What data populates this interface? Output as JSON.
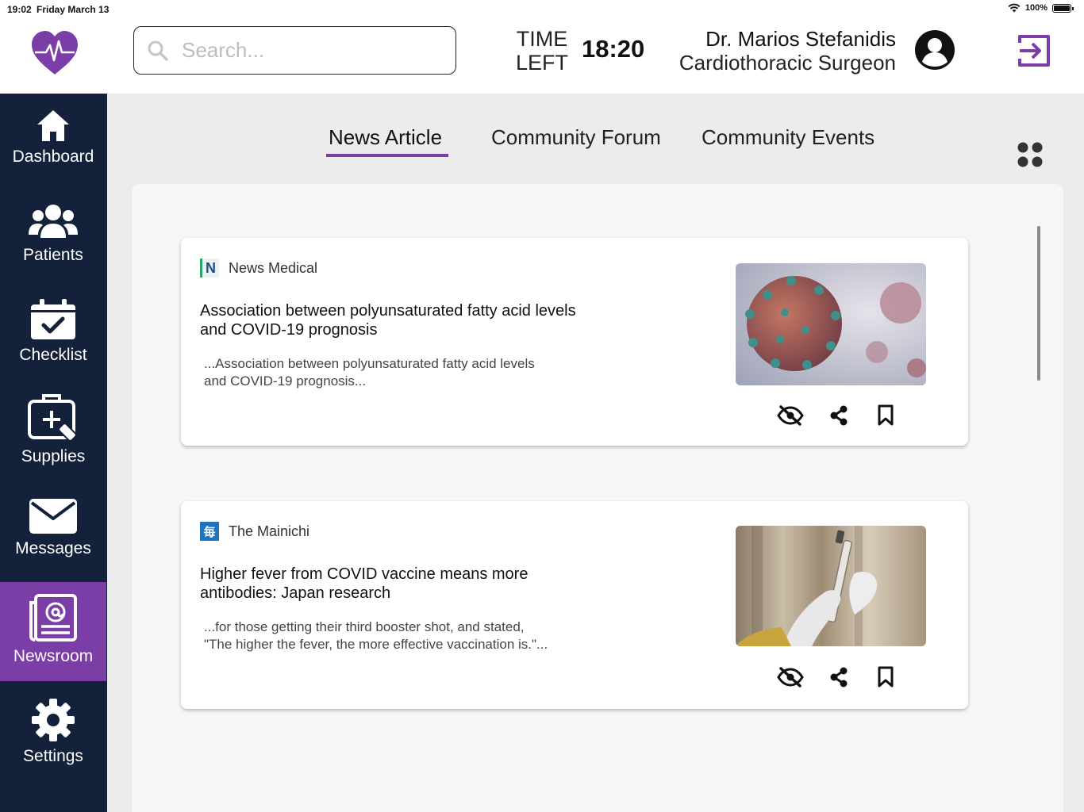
{
  "status_bar": {
    "time": "19:02",
    "date": "Friday March 13",
    "battery": "100%"
  },
  "header": {
    "search_placeholder": "Search...",
    "time_left_label_1": "TIME",
    "time_left_label_2": "LEFT",
    "time_left_value": "18:20",
    "user_name": "Dr. Marios Stefanidis",
    "user_role": "Cardiothoracic Surgeon"
  },
  "colors": {
    "accent": "#7a3ea6",
    "sidebar_bg": "#14213a",
    "panel_bg": "#f6f6f6"
  },
  "sidebar": {
    "items": [
      {
        "label": "Dashboard",
        "icon": "home-icon",
        "active": false
      },
      {
        "label": "Patients",
        "icon": "users-icon",
        "active": false
      },
      {
        "label": "Checklist",
        "icon": "calendar-check-icon",
        "active": false
      },
      {
        "label": "Supplies",
        "icon": "medical-kit-icon",
        "active": false
      },
      {
        "label": "Messages",
        "icon": "envelope-icon",
        "active": false
      },
      {
        "label": "Newsroom",
        "icon": "newspaper-icon",
        "active": true
      },
      {
        "label": "Settings",
        "icon": "gear-icon",
        "active": false
      }
    ]
  },
  "tabs": [
    {
      "label": "News Article",
      "active": true
    },
    {
      "label": "Community Forum",
      "active": false
    },
    {
      "label": "Community Events",
      "active": false
    }
  ],
  "articles": [
    {
      "source": "News Medical",
      "source_logo": "N",
      "title": "Association between polyunsaturated fatty acid levels and COVID-19 prognosis",
      "excerpt": "...Association between polyunsaturated fatty acid levels and COVID-19 prognosis...",
      "image": "virus-image"
    },
    {
      "source": "The Mainichi",
      "source_logo": "毎",
      "title": "Higher fever from COVID vaccine means more antibodies: Japan research",
      "excerpt": "...for those getting their third booster shot, and stated, \"The higher the fever, the more effective vaccination is.\"...",
      "image": "vaccine-syringe-image"
    }
  ]
}
